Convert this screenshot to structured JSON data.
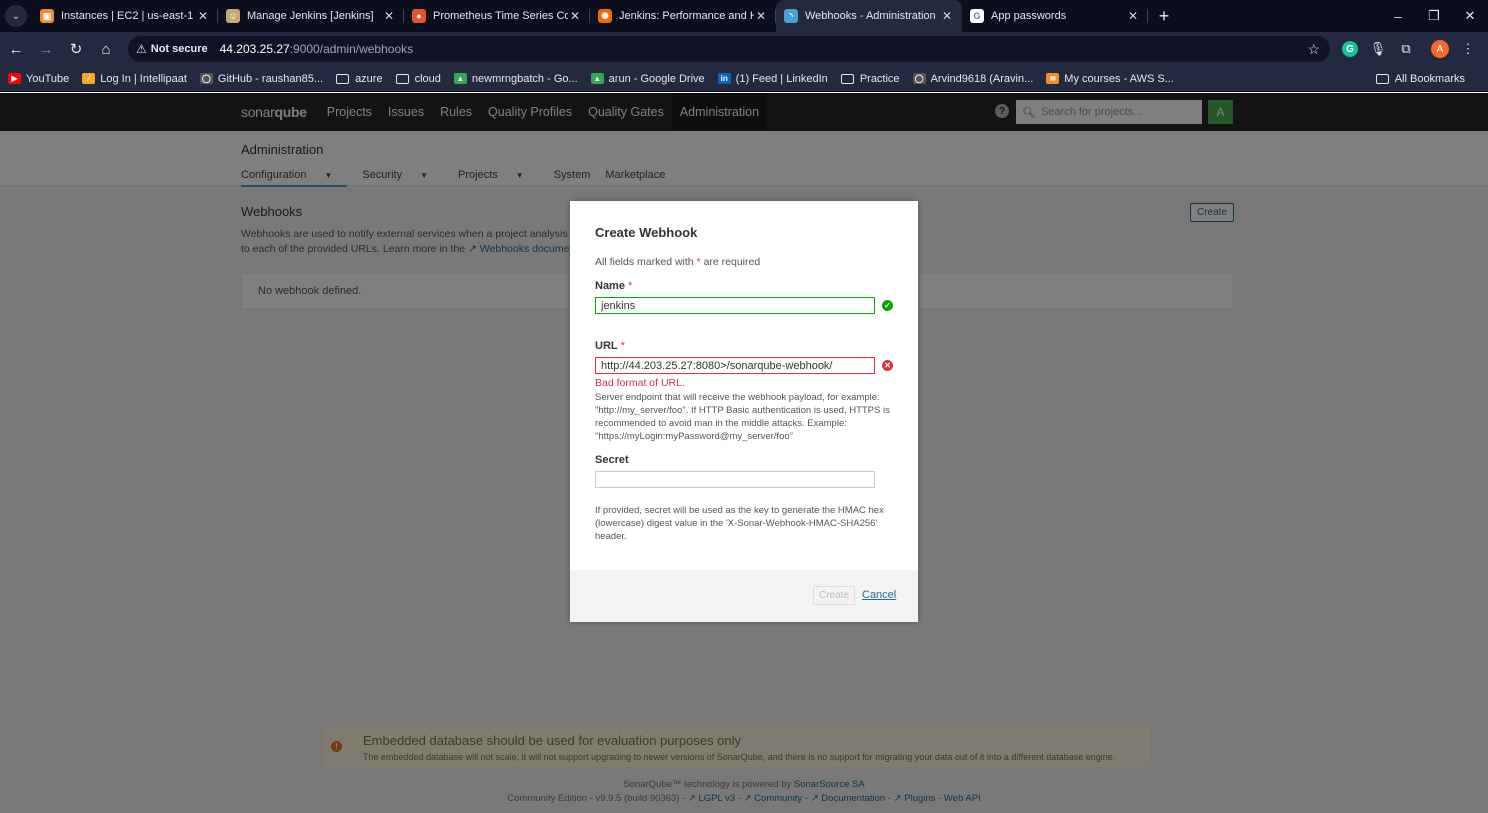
{
  "browser": {
    "tabs": [
      {
        "title": "Instances | EC2 | us-east-1",
        "icon": "aws-icon",
        "color": "#f28c28",
        "glyph": "▣",
        "active": false
      },
      {
        "title": "Manage Jenkins [Jenkins]",
        "icon": "jenkins-icon",
        "color": "#c7a67a",
        "glyph": "☺",
        "active": false
      },
      {
        "title": "Prometheus Time Series Collect",
        "icon": "prometheus-icon",
        "color": "#e6522c",
        "glyph": "●",
        "active": false
      },
      {
        "title": "Jenkins: Performance and Healt",
        "icon": "grafana-icon",
        "color": "#f46800",
        "glyph": "✺",
        "active": false
      },
      {
        "title": "Webhooks - Administration",
        "icon": "sonarqube-icon",
        "color": "#4b9fd5",
        "glyph": "◝",
        "active": true
      },
      {
        "title": "App passwords",
        "icon": "google-icon",
        "color": "#ffffff",
        "glyph": "G",
        "active": false
      }
    ],
    "url": {
      "not_secure": "Not secure",
      "host": "44.203.25.27",
      "path": ":9000/admin/webhooks"
    },
    "bookmarks": [
      {
        "label": "YouTube",
        "type": "site",
        "icon": "youtube-icon",
        "color": "#ff0000",
        "glyph": "▶"
      },
      {
        "label": "Log In | Intellipaat",
        "type": "site",
        "icon": "intellipaat-icon",
        "color": "#f5a623",
        "glyph": "⁄"
      },
      {
        "label": "GitHub - raushan85...",
        "type": "site",
        "icon": "github-icon",
        "color": "#555555",
        "glyph": "◯"
      },
      {
        "label": "azure",
        "type": "folder"
      },
      {
        "label": "cloud",
        "type": "folder"
      },
      {
        "label": "newmrngbatch - Go...",
        "type": "site",
        "icon": "google-drive-icon",
        "color": "#34a853",
        "glyph": "▲"
      },
      {
        "label": "arun - Google Drive",
        "type": "site",
        "icon": "google-drive-icon",
        "color": "#34a853",
        "glyph": "▲"
      },
      {
        "label": "(1) Feed | LinkedIn",
        "type": "site",
        "icon": "linkedin-icon",
        "color": "#0a66c2",
        "glyph": "in"
      },
      {
        "label": "Practice",
        "type": "folder"
      },
      {
        "label": "Arvind9618 (Aravin...",
        "type": "site",
        "icon": "github-icon",
        "color": "#555555",
        "glyph": "◯"
      },
      {
        "label": "My courses - AWS S...",
        "type": "site",
        "icon": "aws-skillbuilder-icon",
        "color": "#f28c28",
        "glyph": "≋"
      }
    ],
    "all_bookmarks": "All Bookmarks",
    "profile_initial": "A"
  },
  "sonarqube": {
    "logo_light": "sonar",
    "logo_bold": "qube",
    "nav": [
      "Projects",
      "Issues",
      "Rules",
      "Quality Profiles",
      "Quality Gates",
      "Administration"
    ],
    "search_placeholder": "Search for projects...",
    "avatar": "A",
    "admin_title": "Administration",
    "admin_menu": [
      "Configuration",
      "Security",
      "Projects",
      "System",
      "Marketplace"
    ],
    "webhooks_title": "Webhooks",
    "webhooks_desc_1": "Webhooks are used to notify external services when a project analysis is d",
    "webhooks_desc_2": "to each of the provided URLs. Learn more in the",
    "webhooks_desc_link": "Webhooks documenta",
    "create_button": "Create",
    "empty_text": "No webhook defined.",
    "warning_title": "Embedded database should be used for evaluation purposes only",
    "warning_text": "The embedded database will not scale, it will not support upgrading to newer versions of SonarQube, and there is no support for migrating your data out of it into a different database engine.",
    "footer_line1_prefix": "SonarQube™ technology is powered by",
    "footer_line1_link": "SonarSource SA",
    "footer_edition": "Community Edition - v9.9.5 (build 90363) -",
    "footer_links": [
      "LGPL v3",
      "Community",
      "Documentation",
      "Plugins",
      "Web API"
    ]
  },
  "modal": {
    "title": "Create Webhook",
    "required_prefix": "All fields marked with",
    "required_star": "*",
    "required_suffix": "are required",
    "name_label": "Name",
    "name_value": "jenkins",
    "url_label": "URL",
    "url_value": "http://44.203.25.27:8080>/sonarqube-webhook/",
    "url_error": "Bad format of URL.",
    "url_help": "Server endpoint that will receive the webhook payload, for example: \"http://my_server/foo\". If HTTP Basic authentication is used, HTTPS is recommended to avoid man in the middle attacks. Example: \"https://myLogin:myPassword@my_server/foo\"",
    "secret_label": "Secret",
    "secret_value": "",
    "secret_help": "If provided, secret will be used as the key to generate the HMAC hex (lowercase) digest value in the 'X-Sonar-Webhook-HMAC-SHA256' header.",
    "create_button": "Create",
    "cancel_button": "Cancel"
  }
}
